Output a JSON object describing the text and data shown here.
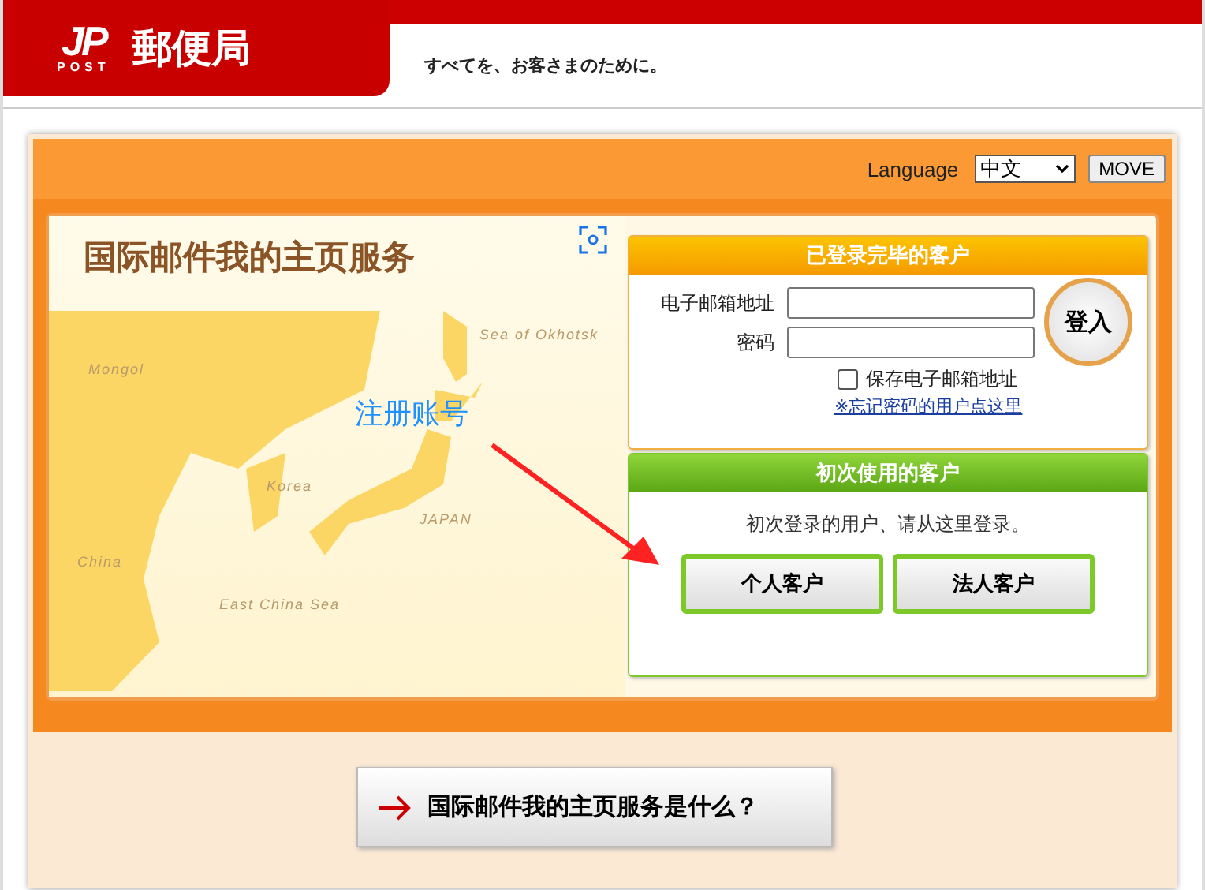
{
  "header": {
    "logo_mark": "JP",
    "logo_sub": "POST",
    "brand": "郵便局",
    "slogan": "すべてを、お客さまのために。"
  },
  "banner": {
    "language_label": "Language",
    "language_value": "中文",
    "move_button": "MOVE"
  },
  "map": {
    "title": "国际邮件我的主页服务",
    "labels": [
      {
        "text": "Sea of Okhotsk"
      },
      {
        "text": "Mongol"
      },
      {
        "text": "Korea"
      },
      {
        "text": "JAPAN"
      },
      {
        "text": "China"
      },
      {
        "text": "East China Sea"
      }
    ]
  },
  "annotation": {
    "text": "注册账号"
  },
  "login": {
    "title": "已登录完毕的客户",
    "email_label": "电子邮箱地址",
    "password_label": "密码",
    "login_button": "登入",
    "remember": {
      "label": "保存电子邮箱地址",
      "checked": false
    },
    "forgot_link": "※忘记密码的用户点这里"
  },
  "first_time": {
    "title": "初次使用的客户",
    "hint": "初次登录的用户、请从这里登录。",
    "buttons": [
      "个人客户",
      "法人客户"
    ]
  },
  "about_button": "国际邮件我的主页服务是什么？"
}
